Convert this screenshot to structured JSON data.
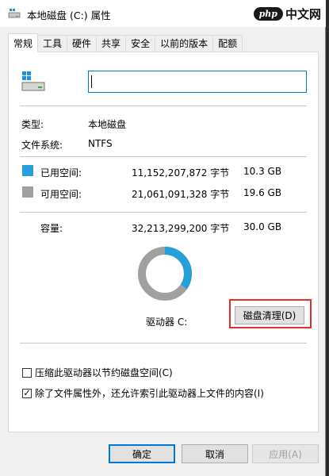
{
  "window": {
    "title": "本地磁盘 (C:) 属性"
  },
  "watermark": {
    "badge": "php",
    "text": "中文网"
  },
  "tabs": [
    {
      "label": "常规"
    },
    {
      "label": "工具"
    },
    {
      "label": "硬件"
    },
    {
      "label": "共享"
    },
    {
      "label": "安全"
    },
    {
      "label": "以前的版本"
    },
    {
      "label": "配额"
    }
  ],
  "general": {
    "name_value": "",
    "type_label": "类型:",
    "type_value": "本地磁盘",
    "fs_label": "文件系统:",
    "fs_value": "NTFS",
    "used": {
      "label": "已用空间:",
      "bytes": "11,152,207,872 字节",
      "gb": "10.3 GB",
      "color": "#26a0da"
    },
    "free": {
      "label": "可用空间:",
      "bytes": "21,061,091,328 字节",
      "gb": "19.6 GB",
      "color": "#a0a0a0"
    },
    "capacity": {
      "label": "容量:",
      "bytes": "32,213,299,200 字节",
      "gb": "30.0 GB"
    },
    "used_fraction": 0.346,
    "drive_label": "驱动器 C:",
    "cleanup_label": "磁盘清理(D)",
    "compress_label": "压缩此驱动器以节约磁盘空间(C)",
    "compress_checked": false,
    "index_label": "除了文件属性外，还允许索引此驱动器上文件的内容(I)",
    "index_checked": true
  },
  "buttons": {
    "ok": "确定",
    "cancel": "取消",
    "apply": "应用(A)"
  }
}
